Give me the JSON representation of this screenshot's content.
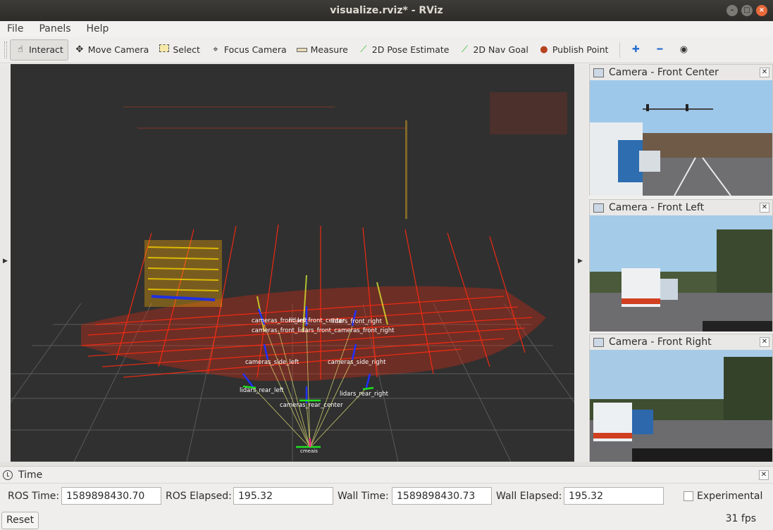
{
  "window": {
    "title": "visualize.rviz* - RViz"
  },
  "menu": [
    "File",
    "Panels",
    "Help"
  ],
  "toolbar": {
    "interact": "Interact",
    "move_camera": "Move Camera",
    "select": "Select",
    "focus_camera": "Focus Camera",
    "measure": "Measure",
    "pose_estimate": "2D Pose Estimate",
    "nav_goal": "2D Nav Goal",
    "publish_point": "Publish Point"
  },
  "cameras": [
    {
      "title": "Camera - Front Center"
    },
    {
      "title": "Camera - Front Left"
    },
    {
      "title": "Camera - Front Right"
    }
  ],
  "frames": {
    "cameras_front_left": "cameras_front_left",
    "lidars_front_center": "lidars_front_center",
    "lidars_front_right": "lidars_front_right",
    "front_row": "cameras_front_lidars_front_cameras_front_right",
    "cameras_side_left": "cameras_side_left",
    "cameras_side_right": "cameras_side_right",
    "lidars_rear_left": "lidars_rear_left",
    "lidars_rear_right": "lidars_rear_right",
    "cameras_rear_center": "cameras_rear_center",
    "base": "cmeais"
  },
  "time": {
    "title": "Time",
    "ros_time_label": "ROS Time:",
    "ros_time": "1589898430.70",
    "ros_elapsed_label": "ROS Elapsed:",
    "ros_elapsed": "195.32",
    "wall_time_label": "Wall Time:",
    "wall_time": "1589898430.73",
    "wall_elapsed_label": "Wall Elapsed:",
    "wall_elapsed": "195.32",
    "experimental": "Experimental",
    "reset": "Reset",
    "fps": "31 fps"
  }
}
